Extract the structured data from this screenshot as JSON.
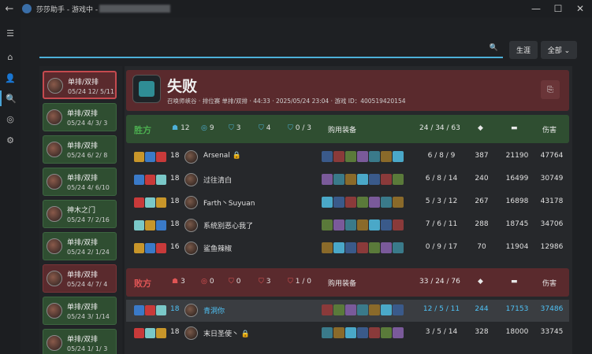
{
  "titlebar": {
    "title": "莎莎助手 - 游戏中 -",
    "back": "←",
    "min": "—",
    "max": "☐",
    "close": "✕"
  },
  "rail": [
    "☰",
    "⌂",
    "👤",
    "🔍",
    "◎",
    "⚙"
  ],
  "search": {
    "value": "",
    "placeholder": "",
    "icon": "🔍"
  },
  "buttons": {
    "create": "生涯",
    "all": "全部 ⌄"
  },
  "matches": [
    {
      "mode": "单排/双排",
      "meta": "05/24 12/ 5/11",
      "result": "loss",
      "selected": true
    },
    {
      "mode": "单排/双排",
      "meta": "05/24 4/ 3/ 3",
      "result": "win"
    },
    {
      "mode": "单排/双排",
      "meta": "05/24 6/ 2/ 8",
      "result": "win"
    },
    {
      "mode": "单排/双排",
      "meta": "05/24 4/ 6/10",
      "result": "win"
    },
    {
      "mode": "神木之门",
      "meta": "05/24 7/ 2/16",
      "result": "win"
    },
    {
      "mode": "单排/双排",
      "meta": "05/24 2/ 1/24",
      "result": "win"
    },
    {
      "mode": "单排/双排",
      "meta": "05/24 4/ 7/ 4",
      "result": "loss"
    },
    {
      "mode": "单排/双排",
      "meta": "05/24 3/ 1/14",
      "result": "win"
    },
    {
      "mode": "单排/双排",
      "meta": "05/24 1/ 1/ 3",
      "result": "win"
    }
  ],
  "detail": {
    "result": "失败",
    "sub": "召唤师峡谷 · 排位赛 单排/双排 · 44:33 · 2025/05/24 23:04 · 游戏 ID：400519420154",
    "copy_icon": "⎘"
  },
  "teams": [
    {
      "name": "胜方",
      "name_color": "#4caf50",
      "result": "win",
      "stats": [
        "12",
        "9",
        "3",
        "4",
        "0 / 3"
      ],
      "col_label": "购用装备",
      "kda": "24 / 34 / 63",
      "gold_icon": "◆",
      "cs_icon": "▬",
      "dmg_label": "伤害",
      "players": [
        {
          "level": "18",
          "name": "Arsenal 🔒",
          "kda": "6 / 8 / 9",
          "cs": "387",
          "gold": "21190",
          "dmg": "47764"
        },
        {
          "level": "18",
          "name": "过往清白",
          "kda": "6 / 8 / 14",
          "cs": "240",
          "gold": "16499",
          "dmg": "30749"
        },
        {
          "level": "18",
          "name": "Farth丶Suyuan",
          "kda": "5 / 3 / 12",
          "cs": "267",
          "gold": "16898",
          "dmg": "43178"
        },
        {
          "level": "18",
          "name": "系统别恶心我了",
          "kda": "7 / 6 / 11",
          "cs": "288",
          "gold": "18745",
          "dmg": "34706"
        },
        {
          "level": "16",
          "name": "鲨鱼辣椒",
          "kda": "0 / 9 / 17",
          "cs": "70",
          "gold": "11904",
          "dmg": "12986"
        }
      ]
    },
    {
      "name": "败方",
      "name_color": "#e05555",
      "result": "loss",
      "stats": [
        "3",
        "0",
        "0",
        "3",
        "1 / 0"
      ],
      "col_label": "购用装备",
      "kda": "33 / 24 / 76",
      "gold_icon": "◆",
      "cs_icon": "▬",
      "dmg_label": "伤害",
      "players": [
        {
          "level": "18",
          "name": "青洞你",
          "kda": "12 / 5 / 11",
          "cs": "244",
          "gold": "17153",
          "dmg": "37486",
          "me": true
        },
        {
          "level": "18",
          "name": "末日圣使丶 🔒",
          "kda": "3 / 5 / 14",
          "cs": "328",
          "gold": "18000",
          "dmg": "33745"
        }
      ]
    }
  ],
  "colors": {
    "accent": "#4db0d8",
    "win": "#2f4e31",
    "loss": "#5a2a2d"
  }
}
